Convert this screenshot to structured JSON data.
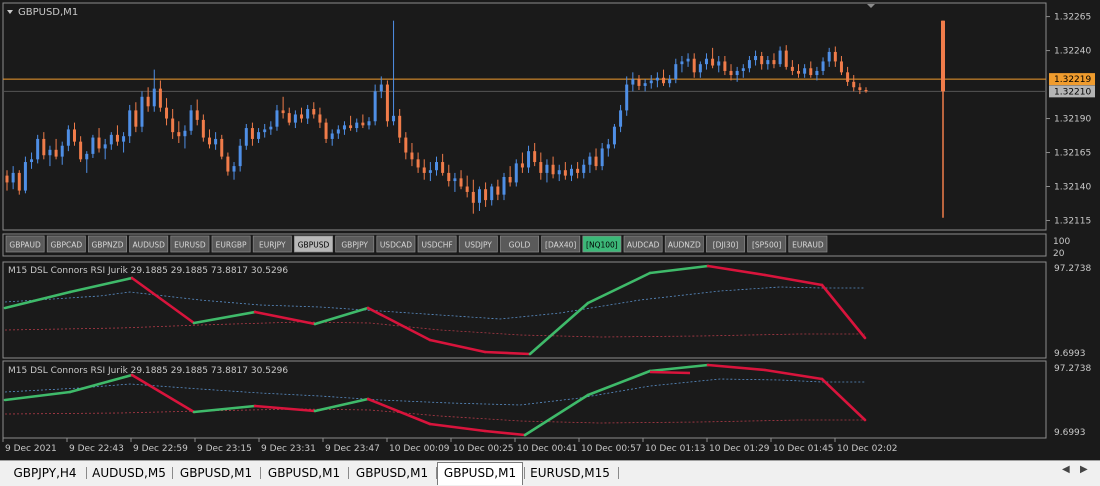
{
  "colors": {
    "background": "#1a1a1a",
    "border": "#8c8c8c",
    "text": "#c8c8c8",
    "bull": "#4f8fe6",
    "bear": "#f07c4a",
    "bid_line": "#f09c2e",
    "ask_line": "#555555",
    "bid_tag": "#f09c2e",
    "ask_tag": "#b4b4b4",
    "rsi_up": "#3fba6a",
    "rsi_down": "#d8143c",
    "band_upper": "#5a8fc8",
    "band_lower": "#b03a48",
    "symbol_button": "#5a5a5a",
    "symbol_active": "#b8b8b8",
    "symbol_highlight": "#3cb878"
  },
  "main_chart": {
    "title": "GBPUSD,M1",
    "ylim": [
      1.32108,
      1.32275
    ],
    "price_ticks": [
      "1.32265",
      "1.32240",
      "1.32190",
      "1.32165",
      "1.32140",
      "1.32115"
    ],
    "bid": {
      "value": 1.32219,
      "label": "1.32219"
    },
    "ask": {
      "value": 1.3221,
      "label": "1.32210"
    },
    "spike": {
      "high": 1.32262,
      "low": 1.32117,
      "body_bottom": 1.3221
    }
  },
  "symbol_buttons": [
    {
      "label": "GBPAUD",
      "state": "normal"
    },
    {
      "label": "GBPCAD",
      "state": "normal"
    },
    {
      "label": "GBPNZD",
      "state": "normal"
    },
    {
      "label": "AUDUSD",
      "state": "normal"
    },
    {
      "label": "EURUSD",
      "state": "normal"
    },
    {
      "label": "EURGBP",
      "state": "normal"
    },
    {
      "label": "EURJPY",
      "state": "normal"
    },
    {
      "label": "GBPUSD",
      "state": "active"
    },
    {
      "label": "GBPJPY",
      "state": "normal"
    },
    {
      "label": "USDCAD",
      "state": "normal"
    },
    {
      "label": "USDCHF",
      "state": "normal"
    },
    {
      "label": "USDJPY",
      "state": "normal"
    },
    {
      "label": "GOLD",
      "state": "normal"
    },
    {
      "label": "[DAX40]",
      "state": "normal"
    },
    {
      "label": "[NQ100]",
      "state": "highlight"
    },
    {
      "label": "AUDCAD",
      "state": "normal"
    },
    {
      "label": "AUDNZD",
      "state": "normal"
    },
    {
      "label": "[DJI30]",
      "state": "normal"
    },
    {
      "label": "[SP500]",
      "state": "normal"
    },
    {
      "label": "EURAUD",
      "state": "normal"
    }
  ],
  "button_strip_scale": [
    "100",
    "20"
  ],
  "indicator_panes": [
    {
      "title": "M15 DSL Connors RSI Jurik 29.1885 29.1885 73.8817 30.5296",
      "max_label": "97.2738",
      "min_label": "9.6993"
    },
    {
      "title": "M15 DSL Connors RSI Jurik 29.1885 29.1885 73.8817 30.5296",
      "max_label": "97.2738",
      "min_label": "9.6993"
    }
  ],
  "time_axis": [
    "9 Dec 2021",
    "9 Dec 22:43",
    "9 Dec 22:59",
    "9 Dec 23:15",
    "9 Dec 23:31",
    "9 Dec 23:47",
    "10 Dec 00:09",
    "10 Dec 00:25",
    "10 Dec 00:41",
    "10 Dec 00:57",
    "10 Dec 01:13",
    "10 Dec 01:29",
    "10 Dec 01:45",
    "10 Dec 02:02"
  ],
  "tabs": [
    {
      "label": "GBPJPY,H4",
      "active": false
    },
    {
      "label": "AUDUSD,M5",
      "active": false
    },
    {
      "label": "GBPUSD,M1",
      "active": false
    },
    {
      "label": "GBPUSD,M1",
      "active": false
    },
    {
      "label": "GBPUSD,M1",
      "active": false
    },
    {
      "label": "GBPUSD,M1",
      "active": true
    },
    {
      "label": "EURUSD,M15",
      "active": false
    }
  ],
  "chart_data": {
    "type": "candlestick",
    "symbol": "GBPUSD",
    "timeframe": "M1",
    "ylim": [
      1.32108,
      1.32275
    ],
    "candles": [
      [
        1.32148,
        1.32152,
        1.32137,
        1.32143
      ],
      [
        1.32143,
        1.32155,
        1.32138,
        1.3215
      ],
      [
        1.3215,
        1.32152,
        1.32134,
        1.32137
      ],
      [
        1.32137,
        1.32162,
        1.32135,
        1.32158
      ],
      [
        1.32158,
        1.32165,
        1.32153,
        1.3216
      ],
      [
        1.3216,
        1.32178,
        1.32157,
        1.32175
      ],
      [
        1.32175,
        1.3218,
        1.3216,
        1.32163
      ],
      [
        1.32163,
        1.3217,
        1.32155,
        1.32167
      ],
      [
        1.32167,
        1.32175,
        1.3216,
        1.32162
      ],
      [
        1.32162,
        1.32173,
        1.32156,
        1.3217
      ],
      [
        1.3217,
        1.32185,
        1.32166,
        1.32182
      ],
      [
        1.32182,
        1.32187,
        1.3217,
        1.32173
      ],
      [
        1.32173,
        1.32177,
        1.32158,
        1.3216
      ],
      [
        1.3216,
        1.32166,
        1.3215,
        1.32164
      ],
      [
        1.32164,
        1.32178,
        1.32161,
        1.32176
      ],
      [
        1.32176,
        1.32183,
        1.32165,
        1.32168
      ],
      [
        1.32168,
        1.32175,
        1.3216,
        1.32171
      ],
      [
        1.32171,
        1.3218,
        1.32167,
        1.32178
      ],
      [
        1.32178,
        1.32185,
        1.3217,
        1.32173
      ],
      [
        1.32173,
        1.3218,
        1.32165,
        1.32177
      ],
      [
        1.32177,
        1.322,
        1.32172,
        1.32196
      ],
      [
        1.32196,
        1.32202,
        1.3218,
        1.32184
      ],
      [
        1.32184,
        1.3221,
        1.3218,
        1.32206
      ],
      [
        1.32206,
        1.32213,
        1.32195,
        1.32199
      ],
      [
        1.32199,
        1.32226,
        1.32195,
        1.32212
      ],
      [
        1.32212,
        1.32218,
        1.32195,
        1.32198
      ],
      [
        1.32198,
        1.32205,
        1.32185,
        1.3219
      ],
      [
        1.3219,
        1.32197,
        1.32175,
        1.3218
      ],
      [
        1.3218,
        1.32188,
        1.32172,
        1.32177
      ],
      [
        1.32177,
        1.32185,
        1.32168,
        1.32181
      ],
      [
        1.32181,
        1.322,
        1.32178,
        1.32196
      ],
      [
        1.32196,
        1.32204,
        1.32185,
        1.32189
      ],
      [
        1.32189,
        1.32193,
        1.32173,
        1.32176
      ],
      [
        1.32176,
        1.32182,
        1.32168,
        1.32171
      ],
      [
        1.32171,
        1.3218,
        1.32167,
        1.32175
      ],
      [
        1.32175,
        1.32178,
        1.3216,
        1.32162
      ],
      [
        1.32162,
        1.32165,
        1.32148,
        1.32151
      ],
      [
        1.32151,
        1.32158,
        1.32145,
        1.32155
      ],
      [
        1.32155,
        1.32175,
        1.32151,
        1.3217
      ],
      [
        1.3217,
        1.32186,
        1.32167,
        1.32183
      ],
      [
        1.32183,
        1.32187,
        1.3217,
        1.32175
      ],
      [
        1.32175,
        1.32183,
        1.32172,
        1.3218
      ],
      [
        1.3218,
        1.32186,
        1.32176,
        1.32182
      ],
      [
        1.32182,
        1.32188,
        1.32178,
        1.32184
      ],
      [
        1.32184,
        1.322,
        1.32181,
        1.32196
      ],
      [
        1.32196,
        1.32206,
        1.3219,
        1.32194
      ],
      [
        1.32194,
        1.32198,
        1.32185,
        1.32187
      ],
      [
        1.32187,
        1.32196,
        1.32183,
        1.32193
      ],
      [
        1.32193,
        1.32198,
        1.32187,
        1.3219
      ],
      [
        1.3219,
        1.322,
        1.32186,
        1.32197
      ],
      [
        1.32197,
        1.32202,
        1.3219,
        1.32193
      ],
      [
        1.32193,
        1.32198,
        1.32183,
        1.32187
      ],
      [
        1.32187,
        1.3219,
        1.32172,
        1.32175
      ],
      [
        1.32175,
        1.32182,
        1.3217,
        1.32179
      ],
      [
        1.32179,
        1.32185,
        1.32175,
        1.32182
      ],
      [
        1.32182,
        1.32188,
        1.32178,
        1.32185
      ],
      [
        1.32185,
        1.32192,
        1.32181,
        1.32183
      ],
      [
        1.32183,
        1.3219,
        1.3218,
        1.32187
      ],
      [
        1.32187,
        1.32193,
        1.32183,
        1.32185
      ],
      [
        1.32185,
        1.32191,
        1.32182,
        1.32188
      ],
      [
        1.32188,
        1.32215,
        1.32185,
        1.3221
      ],
      [
        1.3221,
        1.32221,
        1.32205,
        1.32215
      ],
      [
        1.32215,
        1.32218,
        1.32184,
        1.32188
      ],
      [
        1.32188,
        1.32262,
        1.32185,
        1.32192
      ],
      [
        1.32192,
        1.32197,
        1.32172,
        1.32176
      ],
      [
        1.32176,
        1.3218,
        1.3216,
        1.32165
      ],
      [
        1.32165,
        1.32172,
        1.32155,
        1.3216
      ],
      [
        1.3216,
        1.32165,
        1.3215,
        1.32154
      ],
      [
        1.32154,
        1.3216,
        1.32145,
        1.3215
      ],
      [
        1.3215,
        1.32158,
        1.32144,
        1.32152
      ],
      [
        1.32152,
        1.32162,
        1.32148,
        1.32158
      ],
      [
        1.32158,
        1.32164,
        1.32148,
        1.3215
      ],
      [
        1.3215,
        1.32156,
        1.3214,
        1.32144
      ],
      [
        1.32144,
        1.3215,
        1.32136,
        1.32146
      ],
      [
        1.32146,
        1.32152,
        1.32138,
        1.3214
      ],
      [
        1.3214,
        1.32148,
        1.32132,
        1.32136
      ],
      [
        1.32136,
        1.32145,
        1.3212,
        1.32128
      ],
      [
        1.32128,
        1.3214,
        1.32122,
        1.32138
      ],
      [
        1.32138,
        1.32143,
        1.32125,
        1.3213
      ],
      [
        1.3213,
        1.32142,
        1.32126,
        1.3214
      ],
      [
        1.3214,
        1.32145,
        1.3213,
        1.32134
      ],
      [
        1.32134,
        1.3215,
        1.3213,
        1.32147
      ],
      [
        1.32147,
        1.32155,
        1.3214,
        1.32143
      ],
      [
        1.32143,
        1.3216,
        1.3214,
        1.32157
      ],
      [
        1.32157,
        1.32165,
        1.3215,
        1.32154
      ],
      [
        1.32154,
        1.3217,
        1.3215,
        1.32166
      ],
      [
        1.32166,
        1.32172,
        1.32155,
        1.32158
      ],
      [
        1.32158,
        1.32165,
        1.32145,
        1.3215
      ],
      [
        1.3215,
        1.3216,
        1.32143,
        1.32156
      ],
      [
        1.32156,
        1.32162,
        1.32146,
        1.32149
      ],
      [
        1.32149,
        1.32156,
        1.32144,
        1.32152
      ],
      [
        1.32152,
        1.32158,
        1.32145,
        1.32148
      ],
      [
        1.32148,
        1.32156,
        1.32144,
        1.32153
      ],
      [
        1.32153,
        1.32158,
        1.32146,
        1.3215
      ],
      [
        1.3215,
        1.3216,
        1.32146,
        1.32156
      ],
      [
        1.32156,
        1.32165,
        1.3215,
        1.32162
      ],
      [
        1.32162,
        1.32168,
        1.32152,
        1.32155
      ],
      [
        1.32155,
        1.32172,
        1.32152,
        1.32168
      ],
      [
        1.32168,
        1.32175,
        1.32162,
        1.32171
      ],
      [
        1.32171,
        1.32186,
        1.32168,
        1.32184
      ],
      [
        1.32184,
        1.322,
        1.3218,
        1.32196
      ],
      [
        1.32196,
        1.32221,
        1.32192,
        1.32215
      ],
      [
        1.32215,
        1.32224,
        1.3221,
        1.32219
      ],
      [
        1.32219,
        1.32222,
        1.32211,
        1.32214
      ],
      [
        1.32214,
        1.32219,
        1.3221,
        1.32216
      ],
      [
        1.32216,
        1.32222,
        1.32212,
        1.32218
      ],
      [
        1.32218,
        1.32224,
        1.32213,
        1.3222
      ],
      [
        1.3222,
        1.32226,
        1.32214,
        1.32216
      ],
      [
        1.32216,
        1.32222,
        1.32213,
        1.32219
      ],
      [
        1.32219,
        1.32234,
        1.32216,
        1.3223
      ],
      [
        1.3223,
        1.32236,
        1.32224,
        1.32232
      ],
      [
        1.32232,
        1.32238,
        1.32228,
        1.32234
      ],
      [
        1.32234,
        1.32238,
        1.3222,
        1.32224
      ],
      [
        1.32224,
        1.32232,
        1.3222,
        1.3223
      ],
      [
        1.3223,
        1.32238,
        1.32226,
        1.32234
      ],
      [
        1.32234,
        1.32242,
        1.32227,
        1.32229
      ],
      [
        1.32229,
        1.32236,
        1.32224,
        1.32232
      ],
      [
        1.32232,
        1.32236,
        1.32222,
        1.32225
      ],
      [
        1.32225,
        1.3223,
        1.32218,
        1.32222
      ],
      [
        1.32222,
        1.32228,
        1.32217,
        1.32225
      ],
      [
        1.32225,
        1.3223,
        1.3222,
        1.32227
      ],
      [
        1.32227,
        1.32236,
        1.32224,
        1.32233
      ],
      [
        1.32233,
        1.3224,
        1.32229,
        1.32236
      ],
      [
        1.32236,
        1.32239,
        1.32226,
        1.3223
      ],
      [
        1.3223,
        1.32236,
        1.32226,
        1.32233
      ],
      [
        1.32233,
        1.32238,
        1.32227,
        1.3223
      ],
      [
        1.3223,
        1.32243,
        1.32228,
        1.3224
      ],
      [
        1.3224,
        1.32244,
        1.32226,
        1.32228
      ],
      [
        1.32228,
        1.32233,
        1.32222,
        1.32225
      ],
      [
        1.32225,
        1.3223,
        1.3222,
        1.32223
      ],
      [
        1.32223,
        1.3223,
        1.3222,
        1.32227
      ],
      [
        1.32227,
        1.32232,
        1.3222,
        1.32222
      ],
      [
        1.32222,
        1.32228,
        1.32218,
        1.32225
      ],
      [
        1.32225,
        1.32235,
        1.32222,
        1.32232
      ],
      [
        1.32232,
        1.32242,
        1.32228,
        1.32239
      ],
      [
        1.32239,
        1.32243,
        1.32228,
        1.32232
      ],
      [
        1.32232,
        1.32236,
        1.32222,
        1.32224
      ],
      [
        1.32224,
        1.32228,
        1.32214,
        1.32217
      ],
      [
        1.32217,
        1.32222,
        1.3221,
        1.32213
      ],
      [
        1.32213,
        1.32216,
        1.32208,
        1.32211
      ],
      [
        1.32211,
        1.32213,
        1.32209,
        1.3221
      ]
    ]
  }
}
